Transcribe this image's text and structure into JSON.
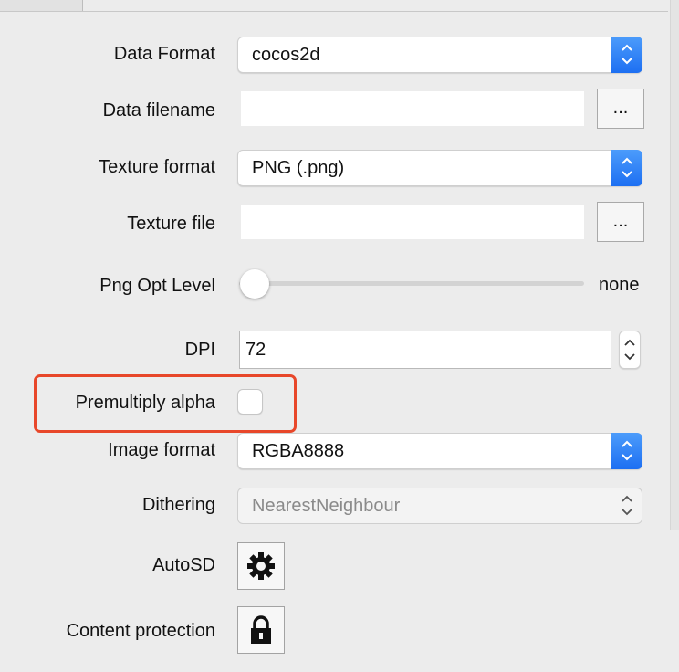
{
  "form": {
    "data_format": {
      "label": "Data Format",
      "value": "cocos2d"
    },
    "data_filename": {
      "label": "Data filename",
      "value": "",
      "browse_label": "..."
    },
    "texture_format": {
      "label": "Texture format",
      "value": "PNG (.png)"
    },
    "texture_file": {
      "label": "Texture file",
      "value": "",
      "browse_label": "..."
    },
    "png_opt_level": {
      "label": "Png Opt Level",
      "value_text": "none",
      "level": 0
    },
    "dpi": {
      "label": "DPI",
      "value": "72"
    },
    "premultiply_alpha": {
      "label": "Premultiply alpha",
      "checked": false
    },
    "image_format": {
      "label": "Image format",
      "value": "RGBA8888"
    },
    "dithering": {
      "label": "Dithering",
      "value": "NearestNeighbour",
      "enabled": false
    },
    "autosd": {
      "label": "AutoSD",
      "icon": "gear-icon"
    },
    "content_protection": {
      "label": "Content protection",
      "icon": "lock-icon"
    }
  },
  "colors": {
    "accent": "#1d6ff2",
    "highlight": "#e8472a"
  }
}
